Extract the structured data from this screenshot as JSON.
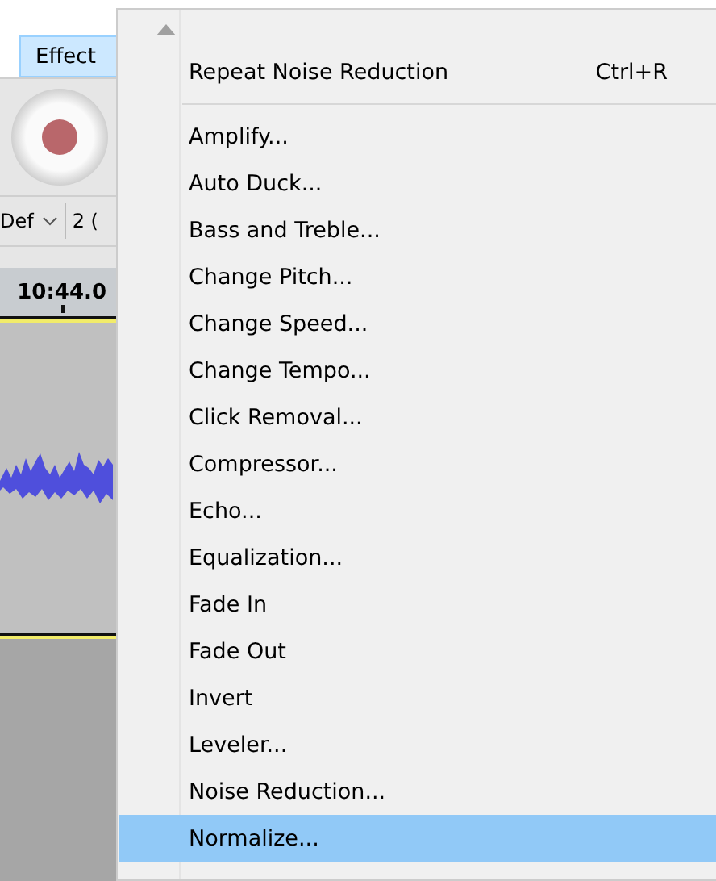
{
  "menu_bar": {
    "items": [
      {
        "label": "Effect",
        "selected": true
      }
    ]
  },
  "toolbar": {
    "device_dropdown": "Def",
    "channels_dropdown": "2 ("
  },
  "timeline": {
    "time": "10:44.0"
  },
  "menu": {
    "repeat_item": {
      "label": "Repeat Noise Reduction",
      "shortcut": "Ctrl+R"
    },
    "items": [
      {
        "label": "Amplify...",
        "selected": false
      },
      {
        "label": "Auto Duck...",
        "selected": false
      },
      {
        "label": "Bass and Treble...",
        "selected": false
      },
      {
        "label": "Change Pitch...",
        "selected": false
      },
      {
        "label": "Change Speed...",
        "selected": false
      },
      {
        "label": "Change Tempo...",
        "selected": false
      },
      {
        "label": "Click Removal...",
        "selected": false
      },
      {
        "label": "Compressor...",
        "selected": false
      },
      {
        "label": "Echo...",
        "selected": false
      },
      {
        "label": "Equalization...",
        "selected": false
      },
      {
        "label": "Fade In",
        "selected": false
      },
      {
        "label": "Fade Out",
        "selected": false
      },
      {
        "label": "Invert",
        "selected": false
      },
      {
        "label": "Leveler...",
        "selected": false
      },
      {
        "label": "Noise Reduction...",
        "selected": false
      },
      {
        "label": "Normalize...",
        "selected": true
      }
    ]
  }
}
